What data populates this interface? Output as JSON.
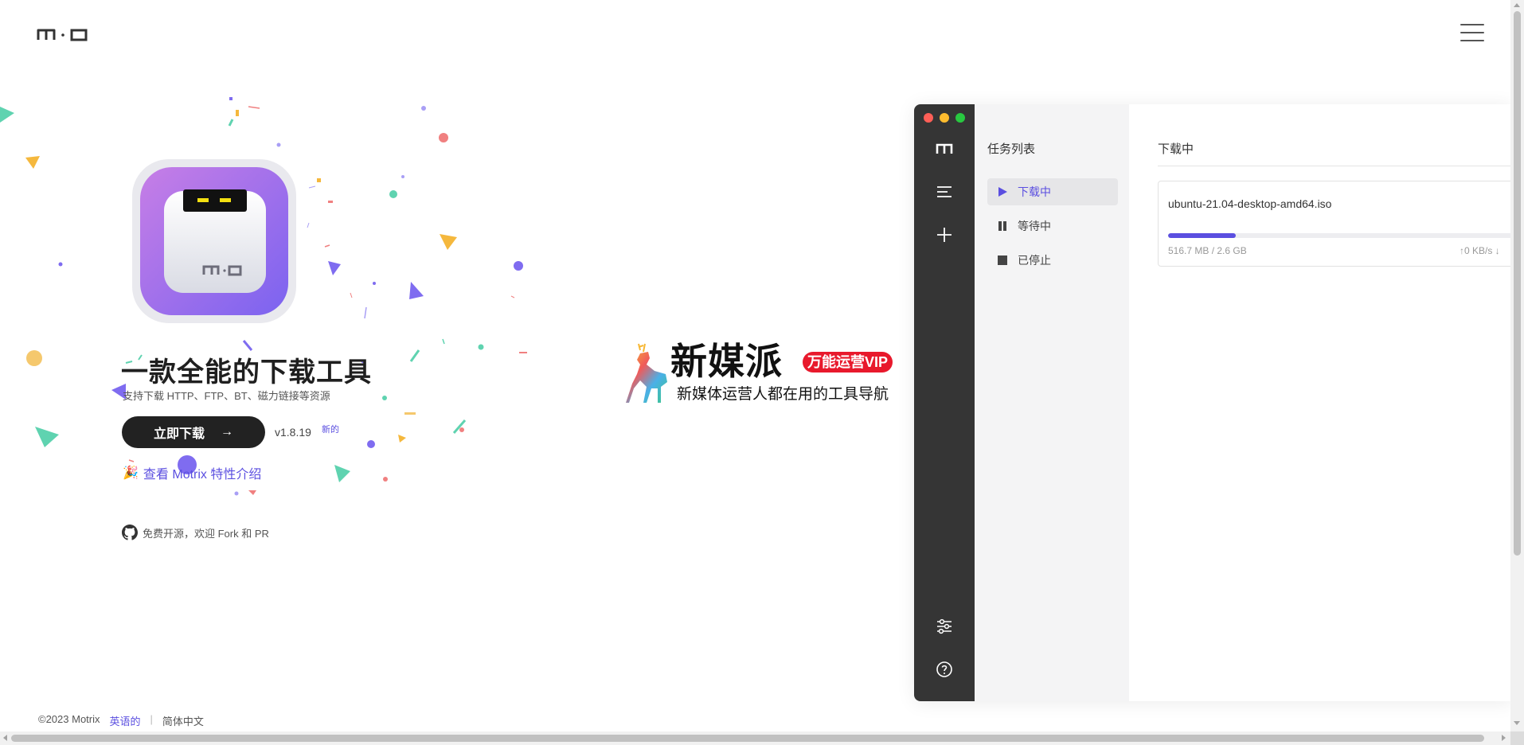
{
  "header": {
    "logo_text": "m·o",
    "menu_icon": "hamburger-menu-icon"
  },
  "hero": {
    "title": "一款全能的下载工具",
    "subtitle": "支持下载 HTTP、FTP、BT、磁力链接等资源",
    "download_label": "立即下载",
    "download_arrow": "→",
    "version": "v1.8.19",
    "new_badge": "新的",
    "features_link": "查看 Motrix 特性介绍",
    "features_icon": "party-popper-icon",
    "oss_text": "免费开源，欢迎 Fork 和 PR",
    "oss_icon": "github-icon",
    "app_icon_text": "m-o"
  },
  "ad": {
    "brand": "新媒派",
    "vip_badge": "万能运营VIP",
    "slogan": "新媒体运营人都在用的工具导航"
  },
  "mockup": {
    "list_title": "任务列表",
    "list_items": [
      {
        "label": "下载中",
        "icon": "play-icon",
        "active": true
      },
      {
        "label": "等待中",
        "icon": "pause-icon",
        "active": false
      },
      {
        "label": "已停止",
        "icon": "stop-icon",
        "active": false
      }
    ],
    "main_title": "下载中",
    "task": {
      "name": "ubuntu-21.04-desktop-amd64.iso",
      "size": "516.7 MB / 2.6 GB",
      "speed": "↑0 KB/s ↓",
      "progress": 0.194
    },
    "side_icons": [
      "logo-icon",
      "task-list-icon",
      "add-icon",
      "settings-icon",
      "help-icon"
    ]
  },
  "footer": {
    "copyright": "©2023 Motrix",
    "lang_en": "英语的",
    "separator": "|",
    "lang_zh": "简体中文"
  },
  "colors": {
    "accent": "#5b4fe0",
    "dark": "#222222",
    "sidebar": "#353535",
    "light_red": "#ff5f57",
    "light_yellow": "#febc2e",
    "light_green": "#28c840"
  }
}
